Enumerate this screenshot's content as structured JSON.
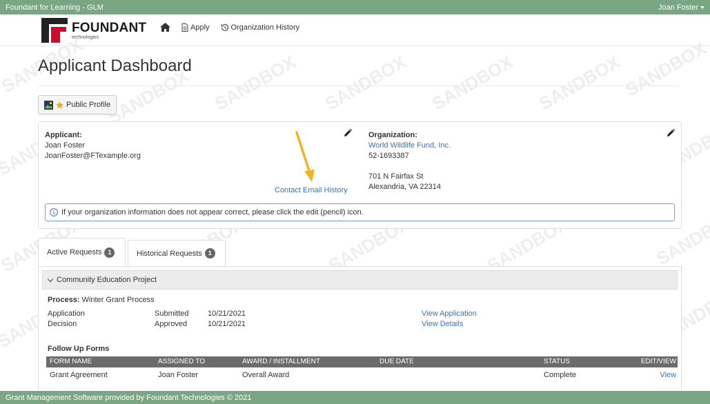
{
  "topbar": {
    "app_name": "Foundant for Learning - GLM",
    "user_name": "Joan Foster"
  },
  "navbar": {
    "logo_text": "FOUNDANT",
    "logo_subtext": "technologies",
    "apply_label": "Apply",
    "history_label": "Organization History"
  },
  "page": {
    "title": "Applicant Dashboard",
    "public_profile_label": "Public Profile"
  },
  "applicant": {
    "heading": "Applicant:",
    "name": "Joan Foster",
    "email": "JoanFoster@FTexample.org",
    "contact_history_label": "Contact Email History"
  },
  "organization": {
    "heading": "Organization:",
    "name": "World Wildlife Fund, Inc.",
    "tax_id": "52-1693387",
    "address1": "701 N Fairfax St",
    "address2": "Alexandria, VA 22314"
  },
  "alert": {
    "text": "If your organization information does not appear correct, please click the edit (pencil) icon."
  },
  "tabs": [
    {
      "label": "Active Requests",
      "count": "1"
    },
    {
      "label": "Historical Requests",
      "count": "1"
    }
  ],
  "request": {
    "title": "Community Education Project",
    "process_label": "Process:",
    "process_name": "Winter Grant Process",
    "steps": [
      {
        "name": "Application",
        "status": "Submitted",
        "date": "10/21/2021",
        "action": "View Application"
      },
      {
        "name": "Decision",
        "status": "Approved",
        "date": "10/21/2021",
        "action": "View Details"
      }
    ],
    "followup_title": "Follow Up Forms",
    "form_columns": [
      "FORM NAME",
      "ASSIGNED TO",
      "AWARD / INSTALLMENT",
      "DUE DATE",
      "STATUS",
      "EDIT/VIEW"
    ],
    "forms": [
      {
        "name": "Grant Agreement",
        "assigned": "Joan Foster",
        "award": "Overall Award",
        "due": "",
        "status": "Complete",
        "action": "View"
      }
    ]
  },
  "footer": {
    "text": "Grant Management Software provided by Foundant Technologies © 2021"
  },
  "watermark": {
    "text": "SANDBOX"
  },
  "colors": {
    "brand_green": "#7ba683",
    "link_blue": "#3a72b8",
    "alert_border": "#6ea0d8",
    "arrow_yellow": "#f0b323"
  }
}
